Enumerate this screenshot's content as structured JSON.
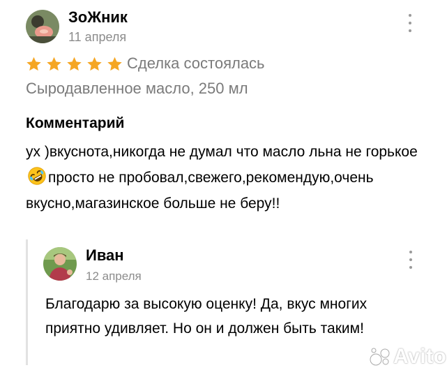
{
  "review": {
    "author": "ЗоЖник",
    "date": "11 апреля",
    "rating": 5,
    "rating_max": 5,
    "deal_status": "Сделка состоялась",
    "product": "Сыродавленное масло, 250 мл",
    "comment_title": "Комментарий",
    "comment_part1": "ух )вкуснота,никогда не думал что масло льна не горькое ",
    "comment_part2": "просто не пробовал,свежего,рекомендую,очень вкусно,магазинское больше не беру!!",
    "emoji": "rolling-on-floor-laughing-emoji"
  },
  "reply": {
    "author": "Иван",
    "date": "12 апреля",
    "text": "Благодарю за высокую оценку! Да, вкус многих приятно удивляет. Но он и должен быть таким!"
  },
  "watermark": {
    "text": "Avito"
  },
  "colors": {
    "star": "#f5a623",
    "muted_text": "#7a7a7a",
    "date_text": "#8c8c8c",
    "accent_bar": "#e2e2e2"
  }
}
